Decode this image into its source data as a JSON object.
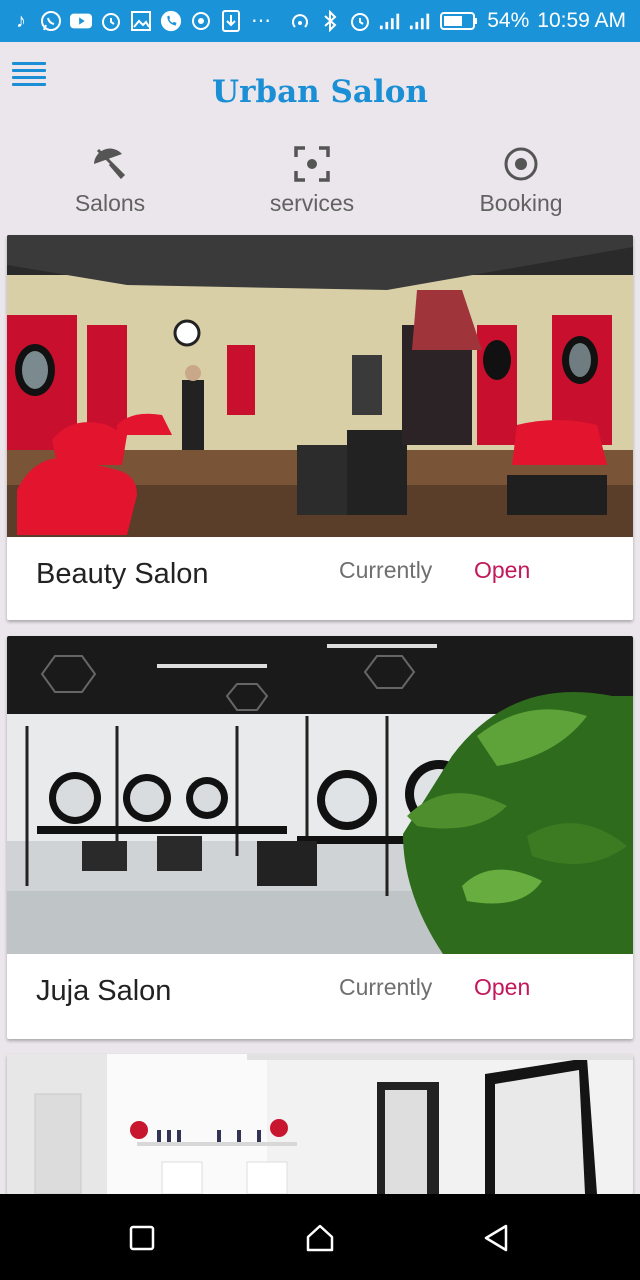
{
  "status_bar": {
    "left_icons": [
      "music-note-icon",
      "whatsapp-icon",
      "youtube-icon",
      "alarm-icon",
      "image-icon",
      "phone-icon",
      "target-icon",
      "download-icon",
      "more-dots-icon"
    ],
    "right_icons": [
      "hotspot-icon",
      "bluetooth-icon",
      "alarm-icon",
      "signal-icon",
      "signal-h-plus-icon",
      "battery-icon"
    ],
    "battery": "54%",
    "time": "10:59 AM"
  },
  "app": {
    "title": "Urban Salon",
    "accent": "#1b8fd5"
  },
  "tabs": [
    {
      "label": "Salons",
      "icon": "umbrella-off-icon"
    },
    {
      "label": "services",
      "icon": "focus-icon"
    },
    {
      "label": "Booking",
      "icon": "radio-target-icon"
    }
  ],
  "salons": [
    {
      "name": "Beauty Salon",
      "currently": "Currently",
      "status": "Open",
      "status_color": "#c2185b"
    },
    {
      "name": "Juja Salon",
      "currently": "Currently",
      "status": "Open",
      "status_color": "#c2185b"
    },
    {
      "name": "",
      "currently": "",
      "status": ""
    }
  ],
  "nav": [
    "recents-square-icon",
    "home-icon",
    "back-triangle-icon"
  ]
}
